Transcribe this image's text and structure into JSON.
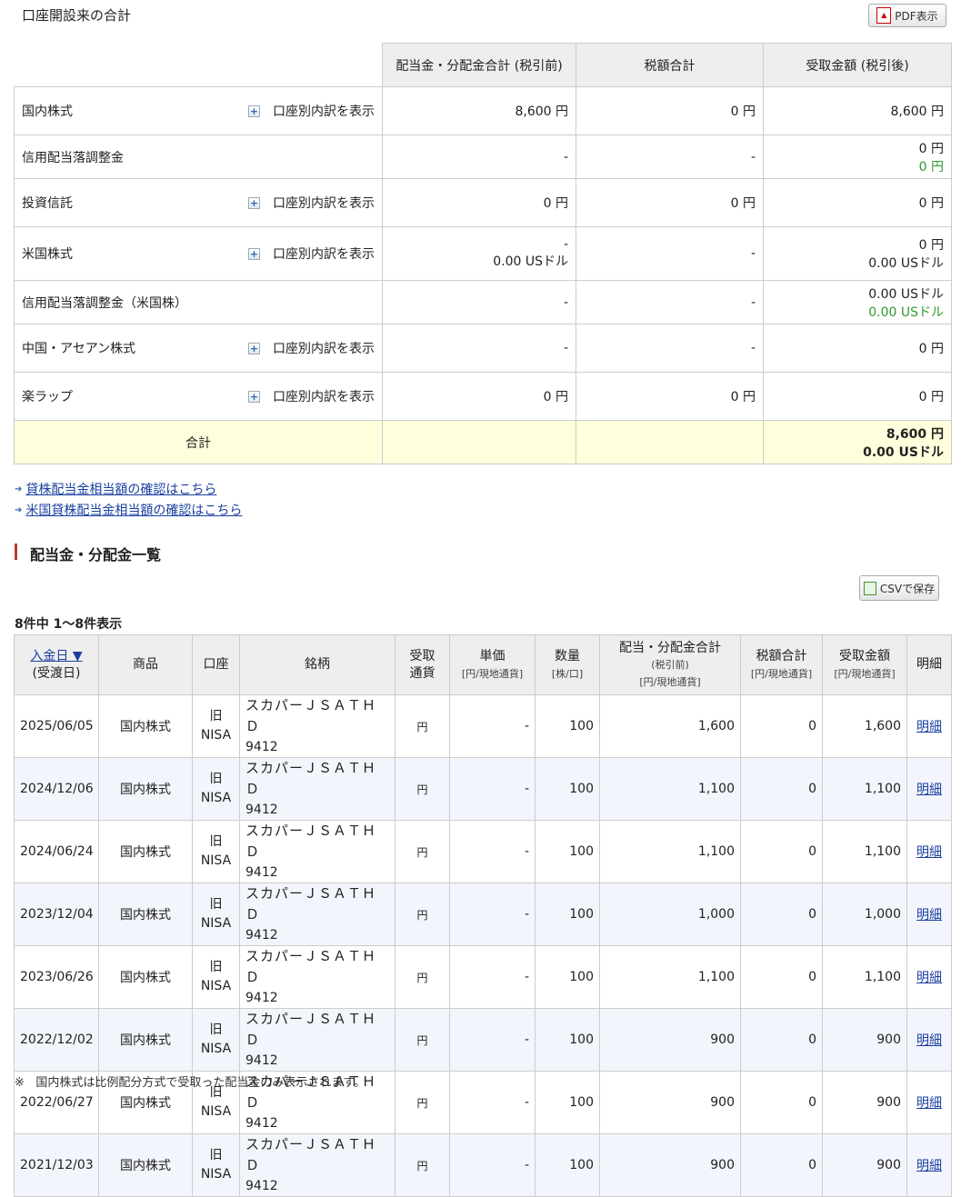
{
  "page_title": "口座開設来の合計",
  "pdf_button": "PDF表示",
  "summary": {
    "headers": [
      "配当金・分配金合計 (税引前)",
      "税額合計",
      "受取金額 (税引後)"
    ],
    "rows": [
      {
        "label": "国内株式",
        "expand": "口座別内訳を表示",
        "pretax": [
          "8,600 円"
        ],
        "tax": [
          "0 円"
        ],
        "net": [
          "8,600 円"
        ],
        "net_green": ""
      },
      {
        "label": "信用配当落調整金",
        "expand": "",
        "pretax": [
          "-"
        ],
        "tax": [
          "-"
        ],
        "net": [
          "0 円"
        ],
        "net_green": "0 円"
      },
      {
        "label": "投資信託",
        "expand": "口座別内訳を表示",
        "pretax": [
          "0 円"
        ],
        "tax": [
          "0 円"
        ],
        "net": [
          "0 円"
        ],
        "net_green": ""
      },
      {
        "label": "米国株式",
        "expand": "口座別内訳を表示",
        "pretax": [
          "-",
          "0.00 USドル"
        ],
        "tax": [
          "-"
        ],
        "net": [
          "0 円",
          "0.00 USドル"
        ],
        "net_green": ""
      },
      {
        "label": "信用配当落調整金（米国株）",
        "expand": "",
        "pretax": [
          "-"
        ],
        "tax": [
          "-"
        ],
        "net": [
          "0.00 USドル"
        ],
        "net_green": "0.00 USドル"
      },
      {
        "label": "中国・アセアン株式",
        "expand": "口座別内訳を表示",
        "pretax": [
          "-"
        ],
        "tax": [
          "-"
        ],
        "net": [
          "0 円"
        ],
        "net_green": ""
      },
      {
        "label": "楽ラップ",
        "expand": "口座別内訳を表示",
        "pretax": [
          "0 円"
        ],
        "tax": [
          "0 円"
        ],
        "net": [
          "0 円"
        ],
        "net_green": ""
      }
    ],
    "total": {
      "label": "合計",
      "net": [
        "8,600 円",
        "0.00 USドル"
      ]
    }
  },
  "links": [
    "貸株配当金相当額の確認はこちら",
    "米国貸株配当金相当額の確認はこちら"
  ],
  "section_title": "配当金・分配金一覧",
  "csv_button": "CSVで保存",
  "count_text": "8件中 1〜8件表示",
  "list": {
    "headers": {
      "date": "入金日 ▼",
      "date_sub": "(受渡日)",
      "product": "商品",
      "account": "口座",
      "symbol": "銘柄",
      "currency1": "受取",
      "currency2": "通貨",
      "unit": "単価",
      "unit_sub": "[円/現地通貨]",
      "qty": "数量",
      "qty_sub": "[株/口]",
      "pretax": "配当・分配金合計",
      "pretax_sub1": "(税引前)",
      "pretax_sub2": "[円/現地通貨]",
      "tax": "税額合計",
      "tax_sub": "[円/現地通貨]",
      "net": "受取金額",
      "net_sub": "[円/現地通貨]",
      "detail": "明細"
    },
    "rows": [
      {
        "date": "2025/06/05",
        "product": "国内株式",
        "account1": "旧",
        "account2": "NISA",
        "symbol": "スカパーＪＳＡＴＨＤ",
        "code": "9412",
        "currency": "円",
        "unit": "-",
        "qty": "100",
        "pretax": "1,600",
        "tax": "0",
        "net": "1,600",
        "detail": "明細"
      },
      {
        "date": "2024/12/06",
        "product": "国内株式",
        "account1": "旧",
        "account2": "NISA",
        "symbol": "スカパーＪＳＡＴＨＤ",
        "code": "9412",
        "currency": "円",
        "unit": "-",
        "qty": "100",
        "pretax": "1,100",
        "tax": "0",
        "net": "1,100",
        "detail": "明細"
      },
      {
        "date": "2024/06/24",
        "product": "国内株式",
        "account1": "旧",
        "account2": "NISA",
        "symbol": "スカパーＪＳＡＴＨＤ",
        "code": "9412",
        "currency": "円",
        "unit": "-",
        "qty": "100",
        "pretax": "1,100",
        "tax": "0",
        "net": "1,100",
        "detail": "明細"
      },
      {
        "date": "2023/12/04",
        "product": "国内株式",
        "account1": "旧",
        "account2": "NISA",
        "symbol": "スカパーＪＳＡＴＨＤ",
        "code": "9412",
        "currency": "円",
        "unit": "-",
        "qty": "100",
        "pretax": "1,000",
        "tax": "0",
        "net": "1,000",
        "detail": "明細"
      },
      {
        "date": "2023/06/26",
        "product": "国内株式",
        "account1": "旧",
        "account2": "NISA",
        "symbol": "スカパーＪＳＡＴＨＤ",
        "code": "9412",
        "currency": "円",
        "unit": "-",
        "qty": "100",
        "pretax": "1,100",
        "tax": "0",
        "net": "1,100",
        "detail": "明細"
      },
      {
        "date": "2022/12/02",
        "product": "国内株式",
        "account1": "旧",
        "account2": "NISA",
        "symbol": "スカパーＪＳＡＴＨＤ",
        "code": "9412",
        "currency": "円",
        "unit": "-",
        "qty": "100",
        "pretax": "900",
        "tax": "0",
        "net": "900",
        "detail": "明細"
      },
      {
        "date": "2022/06/27",
        "product": "国内株式",
        "account1": "旧",
        "account2": "NISA",
        "symbol": "スカパーＪＳＡＴＨＤ",
        "code": "9412",
        "currency": "円",
        "unit": "-",
        "qty": "100",
        "pretax": "900",
        "tax": "0",
        "net": "900",
        "detail": "明細"
      },
      {
        "date": "2021/12/03",
        "product": "国内株式",
        "account1": "旧",
        "account2": "NISA",
        "symbol": "スカパーＪＳＡＴＨＤ",
        "code": "9412",
        "currency": "円",
        "unit": "-",
        "qty": "100",
        "pretax": "900",
        "tax": "0",
        "net": "900",
        "detail": "明細"
      }
    ]
  },
  "note_mark": "※",
  "note": "国内株式は比例配分方式で受取った配当金のみ表示されます。",
  "colors": {
    "accent_red": "#c0392b",
    "link": "#1a3fa0",
    "green": "#2e9a2e",
    "total_bg": "#ffffdd"
  }
}
